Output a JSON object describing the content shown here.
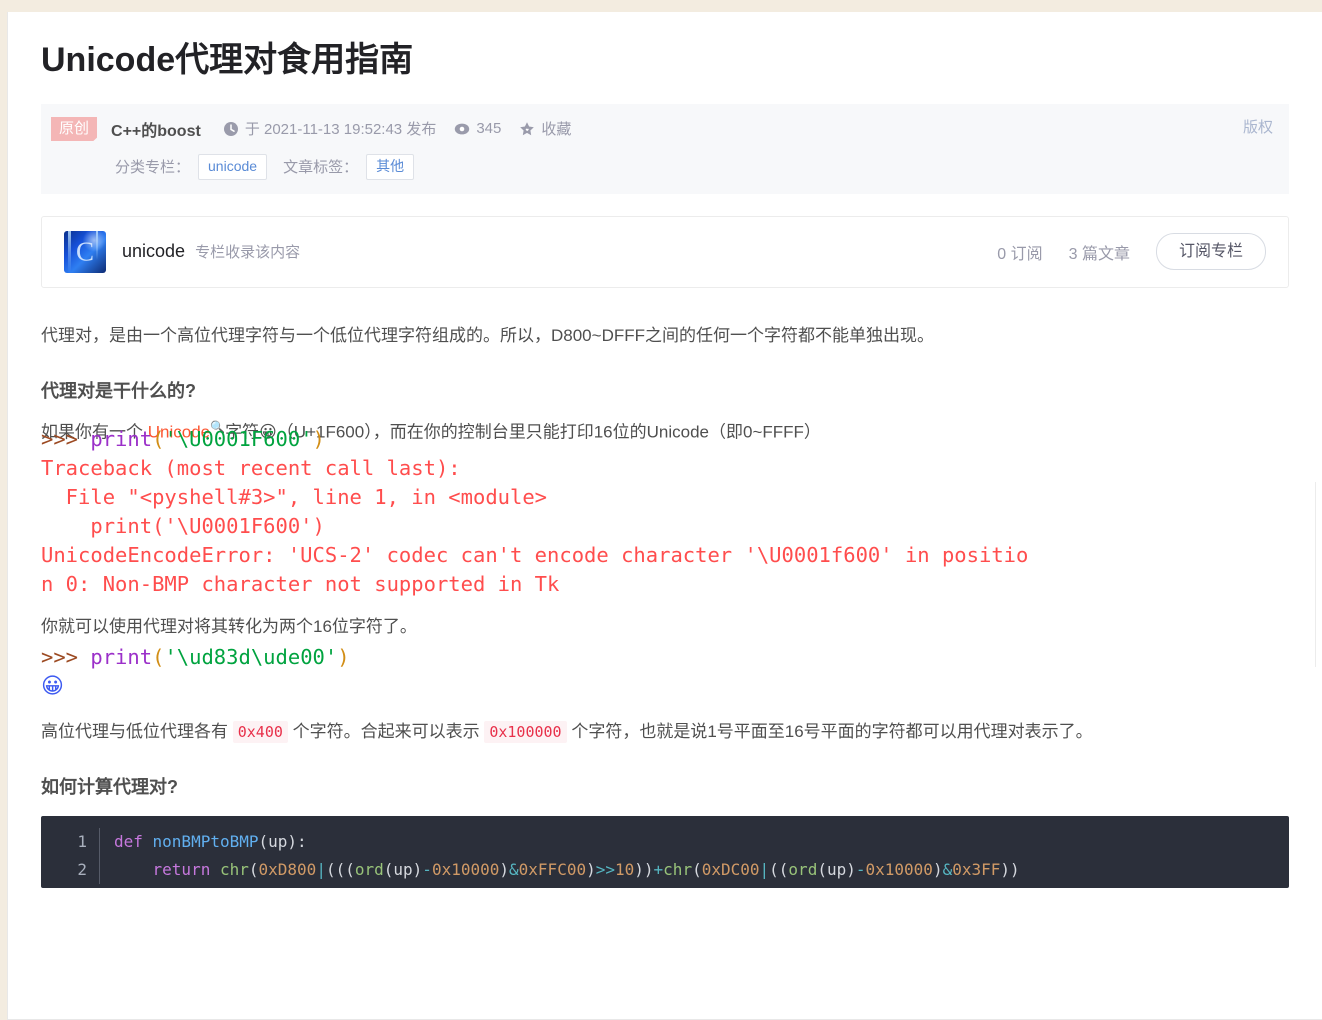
{
  "article": {
    "title": "Unicode代理对食用指南",
    "meta": {
      "original_badge": "原创",
      "author": "C++的boost",
      "clock_icon": "clock-icon",
      "publish_text": "于 2021-11-13 19:52:43 发布",
      "eye_icon": "eye-icon",
      "views": "345",
      "star_icon": "star-icon",
      "collect_label": "收藏",
      "copyright": "版权",
      "category_label": "分类专栏：",
      "category_tag": "unicode",
      "tags_label": "文章标签：",
      "tag": "其他"
    },
    "column": {
      "avatar_icon": "unicode-column-avatar",
      "avatar_glyph": "C",
      "name": "unicode",
      "note": "专栏收录该内容",
      "subscribers": "0 订阅",
      "articles": "3 篇文章",
      "subscribe_button": "订阅专栏"
    },
    "body": {
      "p1": "代理对，是由一个高位代理字符与一个低位代理字符组成的。所以，D800~DFFF之间的任何一个字符都不能单独出现。",
      "h1": "代理对是干什么的?",
      "p2_a": "如果你有一个 ",
      "p2_keyword": "Unicode",
      "p2_search_icon": "search-icon",
      "p2_b": "字符",
      "p2_emoji": "😀",
      "p2_c": "（U+1F600），而在你的控制台里只能打印16位的Unicode（即0~FFFF）",
      "console1": {
        "line1_prompt": ">>> ",
        "line1_fn": "print",
        "line1_open": "(",
        "line1_str": "'\\U0001F600'",
        "line1_close": ")",
        "line2": "Traceback (most recent call last):",
        "line3": "  File \"<pyshell#3>\", line 1, in <module>",
        "line4": "    print('\\U0001F600')",
        "line5": "UnicodeEncodeError: 'UCS-2' codec can't encode character '\\U0001f600' in positio",
        "line6": "n 0: Non-BMP character not supported in Tk"
      },
      "p3": "你就可以使用代理对将其转化为两个16位字符了。",
      "console2": {
        "prompt": ">>> ",
        "fn": "print",
        "open": "(",
        "str": "'\\ud83d\\ude00'",
        "close": ")",
        "output_emoji": "😀"
      },
      "p4_a": "高位代理与低位代理各有 ",
      "p4_code1": "0x400",
      "p4_b": " 个字符。合起来可以表示 ",
      "p4_code2": "0x100000",
      "p4_c": " 个字符，也就是说1号平面至16号平面的字符都可以用代理对表示了。",
      "h2": "如何计算代理对?",
      "codeblock": {
        "lines": [
          {
            "num": "1",
            "tokens": [
              {
                "t": "def ",
                "c": "k"
              },
              {
                "t": "nonBMPtoBMP",
                "c": "fnn"
              },
              {
                "t": "(up):",
                "c": "idn"
              }
            ]
          },
          {
            "num": "2",
            "tokens": [
              {
                "t": "    return ",
                "c": "k"
              },
              {
                "t": "chr",
                "c": "grn"
              },
              {
                "t": "(",
                "c": "idn"
              },
              {
                "t": "0xD800",
                "c": "num"
              },
              {
                "t": "|",
                "c": "op"
              },
              {
                "t": "(((",
                "c": "idn"
              },
              {
                "t": "ord",
                "c": "grn"
              },
              {
                "t": "(up)",
                "c": "idn"
              },
              {
                "t": "-",
                "c": "op"
              },
              {
                "t": "0x10000",
                "c": "num"
              },
              {
                "t": ")",
                "c": "idn"
              },
              {
                "t": "&",
                "c": "op"
              },
              {
                "t": "0xFFC00",
                "c": "num"
              },
              {
                "t": ")",
                "c": "idn"
              },
              {
                "t": ">>",
                "c": "op"
              },
              {
                "t": "10",
                "c": "num"
              },
              {
                "t": "))",
                "c": "idn"
              },
              {
                "t": "+",
                "c": "op"
              },
              {
                "t": "chr",
                "c": "grn"
              },
              {
                "t": "(",
                "c": "idn"
              },
              {
                "t": "0xDC00",
                "c": "num"
              },
              {
                "t": "|",
                "c": "op"
              },
              {
                "t": "((",
                "c": "idn"
              },
              {
                "t": "ord",
                "c": "grn"
              },
              {
                "t": "(up)",
                "c": "idn"
              },
              {
                "t": "-",
                "c": "op"
              },
              {
                "t": "0x10000",
                "c": "num"
              },
              {
                "t": ")",
                "c": "idn"
              },
              {
                "t": "&",
                "c": "op"
              },
              {
                "t": "0x3FF",
                "c": "num"
              },
              {
                "t": "))",
                "c": "idn"
              }
            ]
          }
        ]
      }
    }
  },
  "colors": {
    "page_background": "#f3ece0",
    "card_background": "#ffffff",
    "meta_background": "#f7f8fa",
    "badge_pink": "#f4b6b6",
    "link_blue": "#5a8bd6",
    "muted": "#999aaa",
    "keyword_orange": "#fc5531",
    "inline_code_bg": "#fdf2f4",
    "inline_code_fg": "#e8304a",
    "console_red": "#ff4444",
    "codeblock_bg": "#2b2f3a"
  }
}
